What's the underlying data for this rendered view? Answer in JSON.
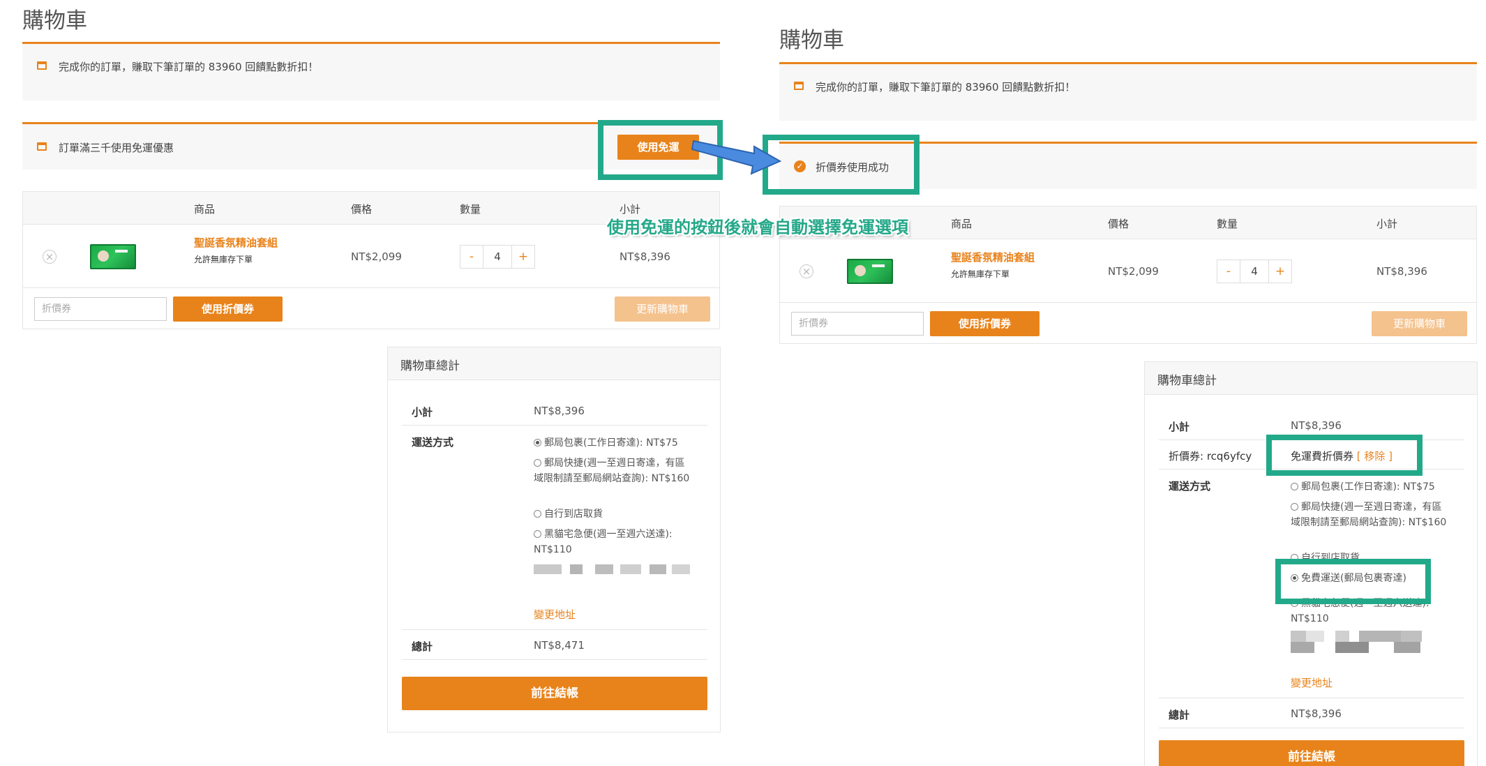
{
  "left": {
    "page_title": "購物車",
    "notice_points": "完成你的訂單，賺取下筆訂單的 83960 回饋點數折扣！",
    "notice_free_shipping": "訂單滿三千使用免運優惠",
    "use_free_shipping_button": "使用免運",
    "table": {
      "headers": [
        "商品",
        "價格",
        "數量",
        "小計"
      ],
      "product_name": "聖誕香氛精油套組",
      "product_note": "允許無庫存下單",
      "price": "NT$2,099",
      "qty_minus": "-",
      "qty": "4",
      "qty_plus": "+",
      "subtotal": "NT$8,396",
      "coupon_placeholder": "折價券",
      "apply_coupon": "使用折價券",
      "update_cart": "更新購物車"
    },
    "totals": {
      "title": "購物車總計",
      "subtotal_label": "小計",
      "subtotal_value": "NT$8,396",
      "shipping_label": "運送方式",
      "options": [
        "郵局包裹(工作日寄達): NT$75",
        "郵局快捷(週一至週日寄達，有區域限制請至郵局網站查詢): NT$160",
        "自行到店取貨",
        "黑貓宅急便(週一至週六送達): NT$110"
      ],
      "change_address": "變更地址",
      "total_label": "總計",
      "total_value": "NT$8,471",
      "checkout": "前往結帳"
    }
  },
  "right": {
    "page_title": "購物車",
    "notice_points": "完成你的訂單，賺取下筆訂單的 83960 回饋點數折扣！",
    "success_message": "折價券使用成功",
    "table": {
      "headers": [
        "商品",
        "價格",
        "數量",
        "小計"
      ],
      "product_name": "聖誕香氛精油套組",
      "product_note": "允許無庫存下單",
      "price": "NT$2,099",
      "qty_minus": "-",
      "qty": "4",
      "qty_plus": "+",
      "subtotal": "NT$8,396",
      "coupon_placeholder": "折價券",
      "apply_coupon": "使用折價券",
      "update_cart": "更新購物車"
    },
    "totals": {
      "title": "購物車總計",
      "subtotal_label": "小計",
      "subtotal_value": "NT$8,396",
      "coupon_label": "折價券: rcq6yfcy",
      "coupon_value": "免運費折價券",
      "coupon_remove": "[ 移除 ]",
      "shipping_label": "運送方式",
      "options": [
        "郵局包裹(工作日寄達): NT$75",
        "郵局快捷(週一至週日寄達，有區域限制請至郵局網站查詢): NT$160",
        "自行到店取貨",
        "免費運送(郵局包裹寄達)",
        "黑貓宅急便(週一至週六送達): NT$110"
      ],
      "selected_option": "免費運送(郵局包裹寄達)",
      "change_address": "變更地址",
      "total_label": "總計",
      "total_value": "NT$8,396",
      "checkout": "前往結帳"
    }
  },
  "annotation": {
    "caption": "使用免運的按鈕後就會自動選擇免運選項",
    "highlight_color": "#22a98a",
    "arrow_color": "#4a8be0"
  },
  "colors": {
    "accent": "#e8831b",
    "accent_faded": "#f4c28d"
  }
}
